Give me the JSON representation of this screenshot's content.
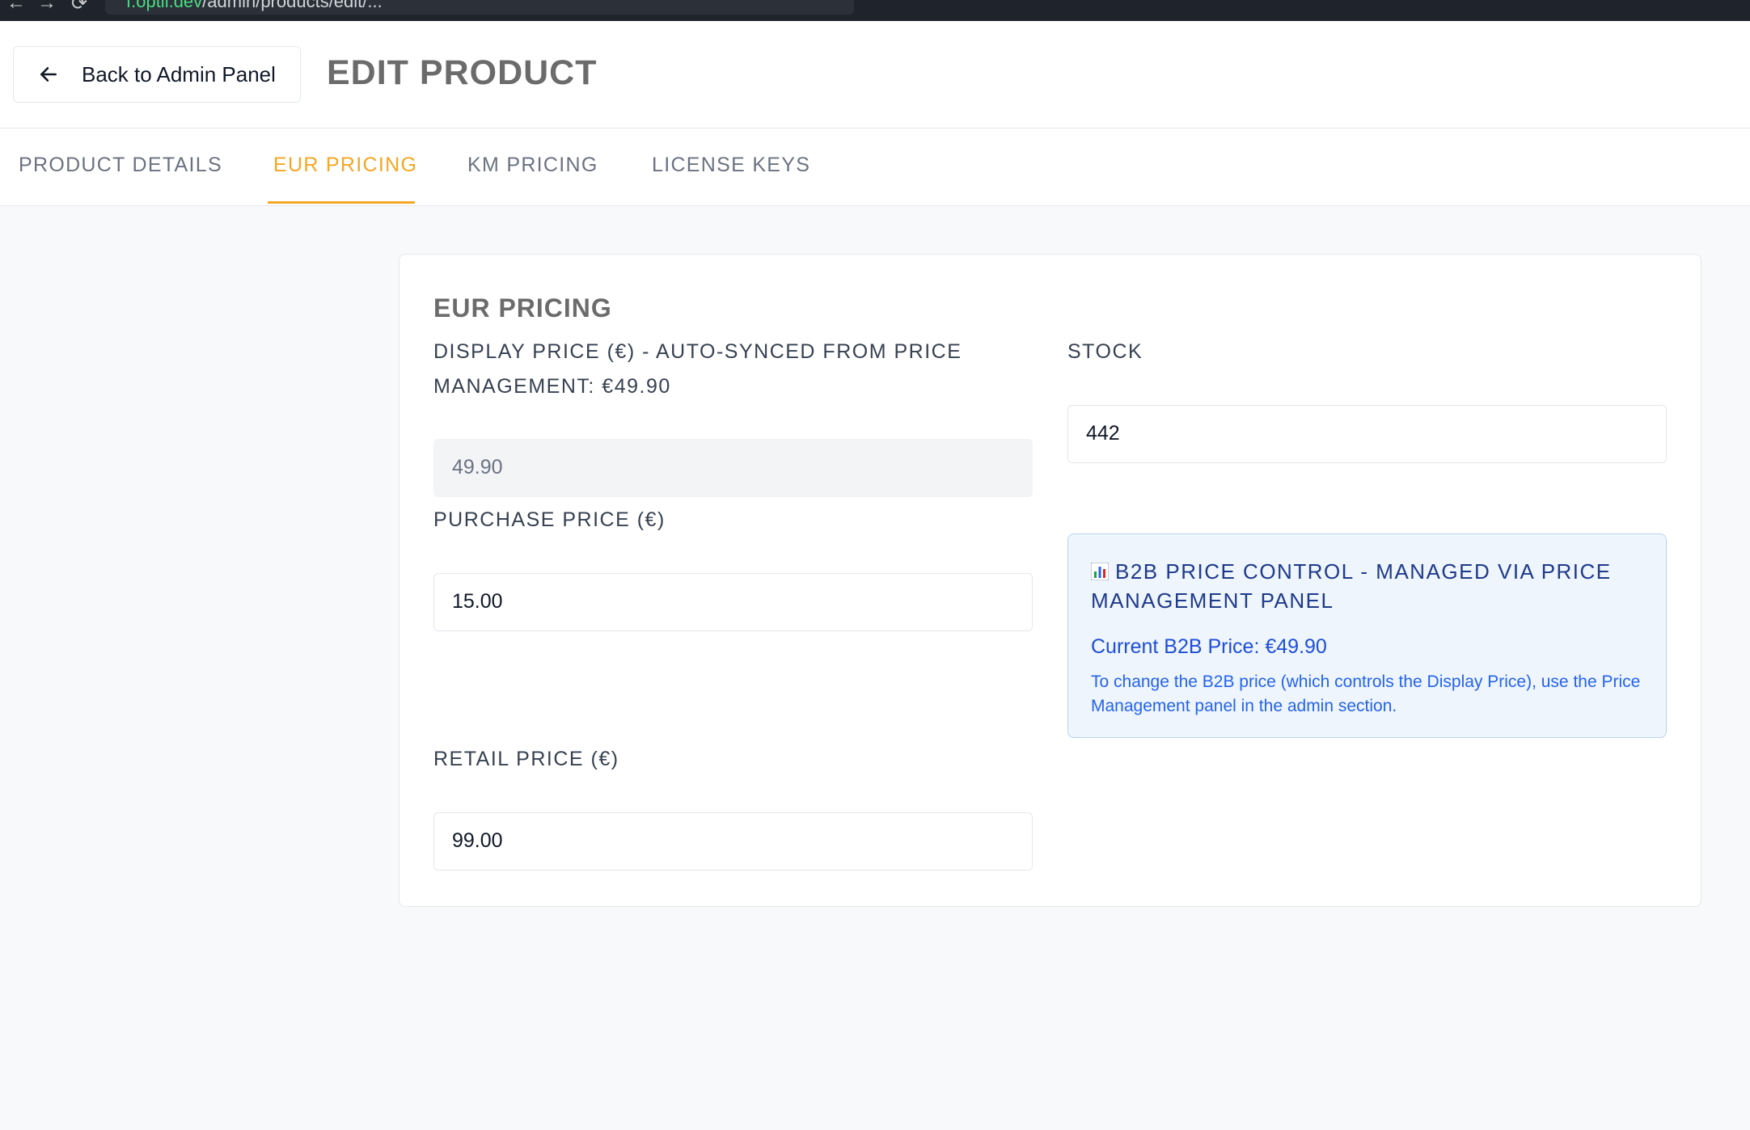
{
  "browser": {
    "url_host": "f.optii.dev",
    "url_path": "/admin/products/edit/...",
    "back_glyph": "←",
    "forward_glyph": "→",
    "reload_glyph": "⟳"
  },
  "header": {
    "back_button_label": "Back to Admin Panel",
    "back_icon": "arrow-left-icon",
    "title": "EDIT PRODUCT"
  },
  "tabs": [
    {
      "label": "PRODUCT DETAILS",
      "active": false
    },
    {
      "label": "EUR PRICING",
      "active": true
    },
    {
      "label": "KM PRICING",
      "active": false
    },
    {
      "label": "LICENSE KEYS",
      "active": false
    }
  ],
  "card": {
    "title": "EUR PRICING",
    "display_price": {
      "label_line1": "DISPLAY PRICE (€) - AUTO-SYNCED FROM PRICE",
      "label_line2": "MANAGEMENT: €49.90",
      "value": "49.90",
      "disabled": true
    },
    "stock": {
      "label": "STOCK",
      "value": "442"
    },
    "purchase_price": {
      "label": "PURCHASE PRICE (€)",
      "value": "15.00"
    },
    "retail_price": {
      "label": "RETAIL PRICE (€)",
      "value": "99.00"
    },
    "b2b_info": {
      "icon": "bar-chart-icon",
      "title": "B2B PRICE CONTROL - MANAGED VIA PRICE MANAGEMENT PANEL",
      "current_price": "Current B2B Price: €49.90",
      "note": "To change the B2B price (which controls the Display Price), use the Price Management panel in the admin section."
    }
  },
  "colors": {
    "accent": "#f5a623",
    "info_bg": "#eef5fd",
    "info_text": "#1e3a8a",
    "info_link": "#2563eb"
  }
}
